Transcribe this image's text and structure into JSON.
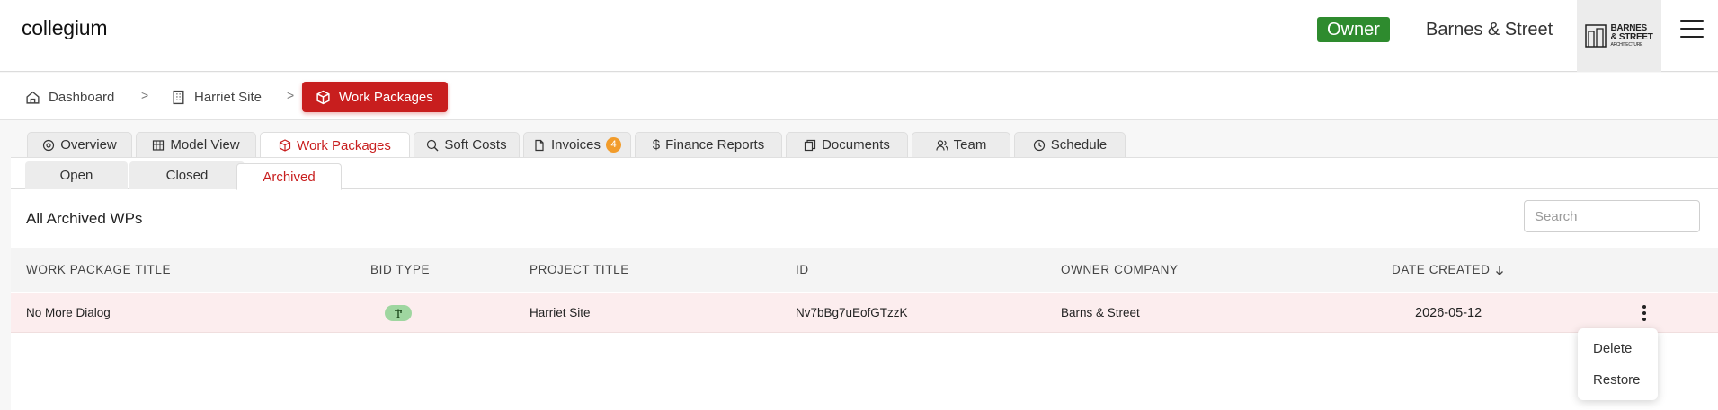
{
  "header": {
    "brand": "collegium",
    "role_badge": "Owner",
    "company_name": "Barnes & Street",
    "logo": {
      "line1": "BARNES",
      "line2": "& STREET",
      "line3": "ARCHITECTURE"
    },
    "menu_icon": "hamburger-icon"
  },
  "breadcrumb": [
    {
      "label": "Dashboard",
      "icon": "home-icon"
    },
    {
      "label": "Harriet Site",
      "icon": "building-icon"
    },
    {
      "label": "Work Packages",
      "icon": "package-icon",
      "active": true
    }
  ],
  "breadcrumb_separator": ">",
  "tabs": [
    {
      "label": "Overview",
      "icon": "overview-icon"
    },
    {
      "label": "Model View",
      "icon": "model-icon"
    },
    {
      "label": "Work Packages",
      "icon": "package-icon",
      "active": true
    },
    {
      "label": "Soft Costs",
      "icon": "search-money-icon"
    },
    {
      "label": "Invoices",
      "icon": "document-icon",
      "badge": "4"
    },
    {
      "label": "Finance Reports",
      "icon": "dollar-icon"
    },
    {
      "label": "Documents",
      "icon": "documents-icon"
    },
    {
      "label": "Team",
      "icon": "team-icon"
    },
    {
      "label": "Schedule",
      "icon": "clock-icon"
    }
  ],
  "subtabs": [
    {
      "label": "Open"
    },
    {
      "label": "Closed"
    },
    {
      "label": "Archived",
      "active": true
    }
  ],
  "section_title": "All Archived WPs",
  "search": {
    "placeholder": "Search",
    "value": ""
  },
  "table": {
    "headers": {
      "title": "Work Package Title",
      "bid_type": "Bid Type",
      "project": "Project Title",
      "id": "ID",
      "owner": "Owner Company",
      "date": "Date Created"
    },
    "sort_icon": "arrow-down-icon",
    "rows": [
      {
        "title": "No More Dialog",
        "bid_type_icon": "crane-icon",
        "project": "Harriet Site",
        "id": "Nv7bBg7uEofGTzzK",
        "owner": "Barns & Street",
        "date": "2026-05-12"
      }
    ]
  },
  "row_menu": {
    "delete": "Delete",
    "restore": "Restore"
  },
  "colors": {
    "accent": "#c81e1e",
    "owner_badge": "#2e8b2e",
    "invoice_badge": "#f29c2b",
    "row_highlight": "#fcedee",
    "bid_chip": "#9fd6a0"
  }
}
